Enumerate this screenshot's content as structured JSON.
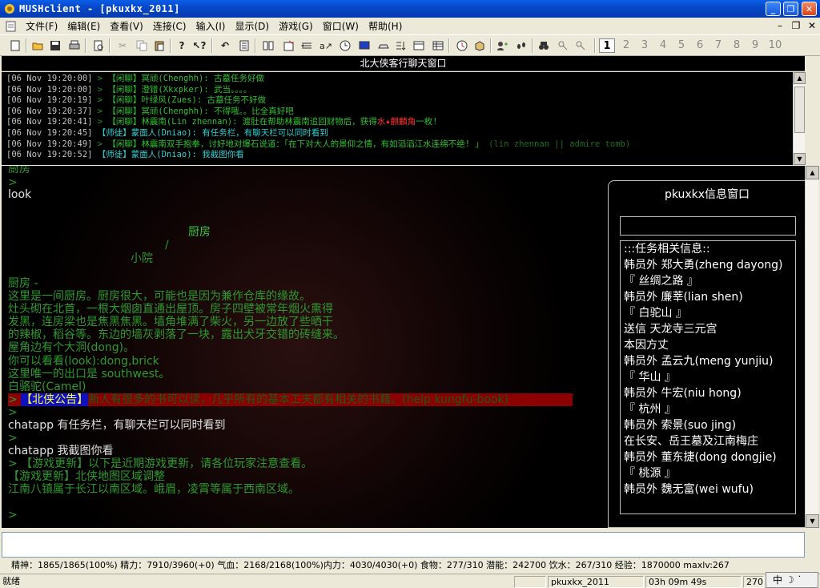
{
  "window": {
    "title": "MUSHclient - [pkuxkx_2011]",
    "minimize": "_",
    "restore": "❐",
    "close": "✕"
  },
  "menu": {
    "items": [
      "文件(F)",
      "编辑(E)",
      "查看(V)",
      "连接(C)",
      "输入(I)",
      "显示(D)",
      "游戏(G)",
      "窗口(W)",
      "帮助(H)"
    ],
    "mdi_minimize": "–",
    "mdi_restore": "❐",
    "mdi_close": "✕"
  },
  "toolbar": {
    "world_numbers": [
      "1",
      "2",
      "3",
      "4",
      "5",
      "6",
      "7",
      "8",
      "9",
      "10"
    ],
    "active_world": "1"
  },
  "chat": {
    "header": "北大侠客行聊天窗口",
    "lines": [
      {
        "ts": "[06 Nov 19:20:00]",
        "arrow": " > ",
        "channel": "【闲聊】",
        "text": "冥顽(Chenghh): 古墓任务好做",
        "ctype": "idle"
      },
      {
        "ts": "[06 Nov 19:20:00]",
        "arrow": " > ",
        "channel": "【闲聊】",
        "text": "澄错(Xkxpker): 武当。。。。",
        "ctype": "idle"
      },
      {
        "ts": "[06 Nov 19:20:19]",
        "arrow": " > ",
        "channel": "【闲聊】",
        "text": "叶绿风(Zues): 古墓任务不好做",
        "ctype": "idle"
      },
      {
        "ts": "[06 Nov 19:20:37]",
        "arrow": " > ",
        "channel": "【闲聊】",
        "text": "冥顽(Chenghh): 不得哦。。比全真好吧",
        "ctype": "idle"
      },
      {
        "ts": "[06 Nov 19:20:41]",
        "arrow": " > ",
        "channel": "【闲聊】",
        "text": "林震南(Lin zhennan): 渡肚在帮助林震南追回财物后，获得",
        "highlight": "水★麒麟角",
        "text2": "一枚!",
        "ctype": "idle"
      },
      {
        "ts": "[06 Nov 19:20:45]",
        "arrow": " ",
        "channel": "【师徒】",
        "text": "蒙面人(Dniao): 有任务栏，有聊天栏可以同时看到",
        "ctype": "tutor"
      },
      {
        "ts": "[06 Nov 19:20:49]",
        "arrow": " > ",
        "channel": "【闲聊】",
        "text": "林震南双手抱拳，讨好地对爆石说道：「在下对大人的景仰之情，有如滔滔江水连绵不绝! 」",
        "en": " (lin zhennan || admire tomb)",
        "ctype": "idle"
      },
      {
        "ts": "[06 Nov 19:20:52]",
        "arrow": " ",
        "channel": "【师徒】",
        "text": "蒙面人(Dniao): 我截图你看",
        "ctype": "tutor"
      }
    ]
  },
  "main": {
    "partial_top": "厨房",
    "prompt": ">",
    "cmd_look": "look",
    "map_kitchen": "厨房",
    "map_slash": "/",
    "map_yard": "小院",
    "room_title": "厨房 -",
    "desc": [
      "    这里是一间厨房。厨房很大，可能也是因为兼作仓库的缘故。",
      "灶头砌在北首，一根大烟囱直通出屋顶。房子四壁被常年烟火熏得",
      "发黑，连房梁也是焦黑焦黑。墙角堆满了柴火，另一边放了些晒干",
      "的辣椒，稻谷等。东边的墙灰剥落了一块，露出犬牙交错的砖缝来。",
      "屋角边有个大洞(dong)。"
    ],
    "look_hint": "    你可以看看(look):dong,brick",
    "exit_line": "    这里唯一的出口是 southwest。",
    "npc": "    白骆驼(Camel)",
    "announce_prefix": "> ",
    "announce_tag": "【北侠公告】",
    "announce_text": "新人有很多的书可以读，几乎所有的基本工夫都有相关的书籍。(help kungfu-book)",
    "chat1": "chatapp 有任务栏，有聊天栏可以同时看到",
    "chat2": "chatapp 我截图你看",
    "update1": "> 【游戏更新】以下是近期游戏更新，请各位玩家注意查看。",
    "update2": "【游戏更新】北侠地图区域调整",
    "update3": "江南八镇属于长江以南区域。峨眉，凌霄等属于西南区域。",
    "last_prompt": ">"
  },
  "info": {
    "title": "pkuxkx信息窗口",
    "lines": [
      ":::任务相关信息::",
      "韩员外 郑大勇(zheng dayong)",
      " 『 丝绸之路 』",
      "韩员外 廉莘(lian shen)",
      " 『 白驼山 』",
      "送信 天龙寺三元宫",
      " 本因方丈",
      "韩员外 孟云九(meng yunjiu)",
      " 『 华山 』",
      "韩员外 牛宏(niu hong)",
      " 『 杭州 』",
      "韩员外 索景(suo jing)",
      " 在长安、岳王墓及江南梅庄",
      "韩员外 董东捷(dong dongjie)",
      " 『 桃源 』",
      "韩员外 魏无富(wei wufu)"
    ]
  },
  "stats": "精神：1865/1865(100%)  精力：7910/3960(+0)  气血：2168/2168(100%)内力：4030/4030(+0)  食物：277/310  潜能：242700  饮水：267/310  经验：1870000 maxlv:267",
  "statusbar": {
    "ready": "就绪",
    "world": "pkuxkx_2011",
    "time": "03h 09m 49s",
    "extra": "270"
  },
  "ime": "中 ☽ ˙"
}
